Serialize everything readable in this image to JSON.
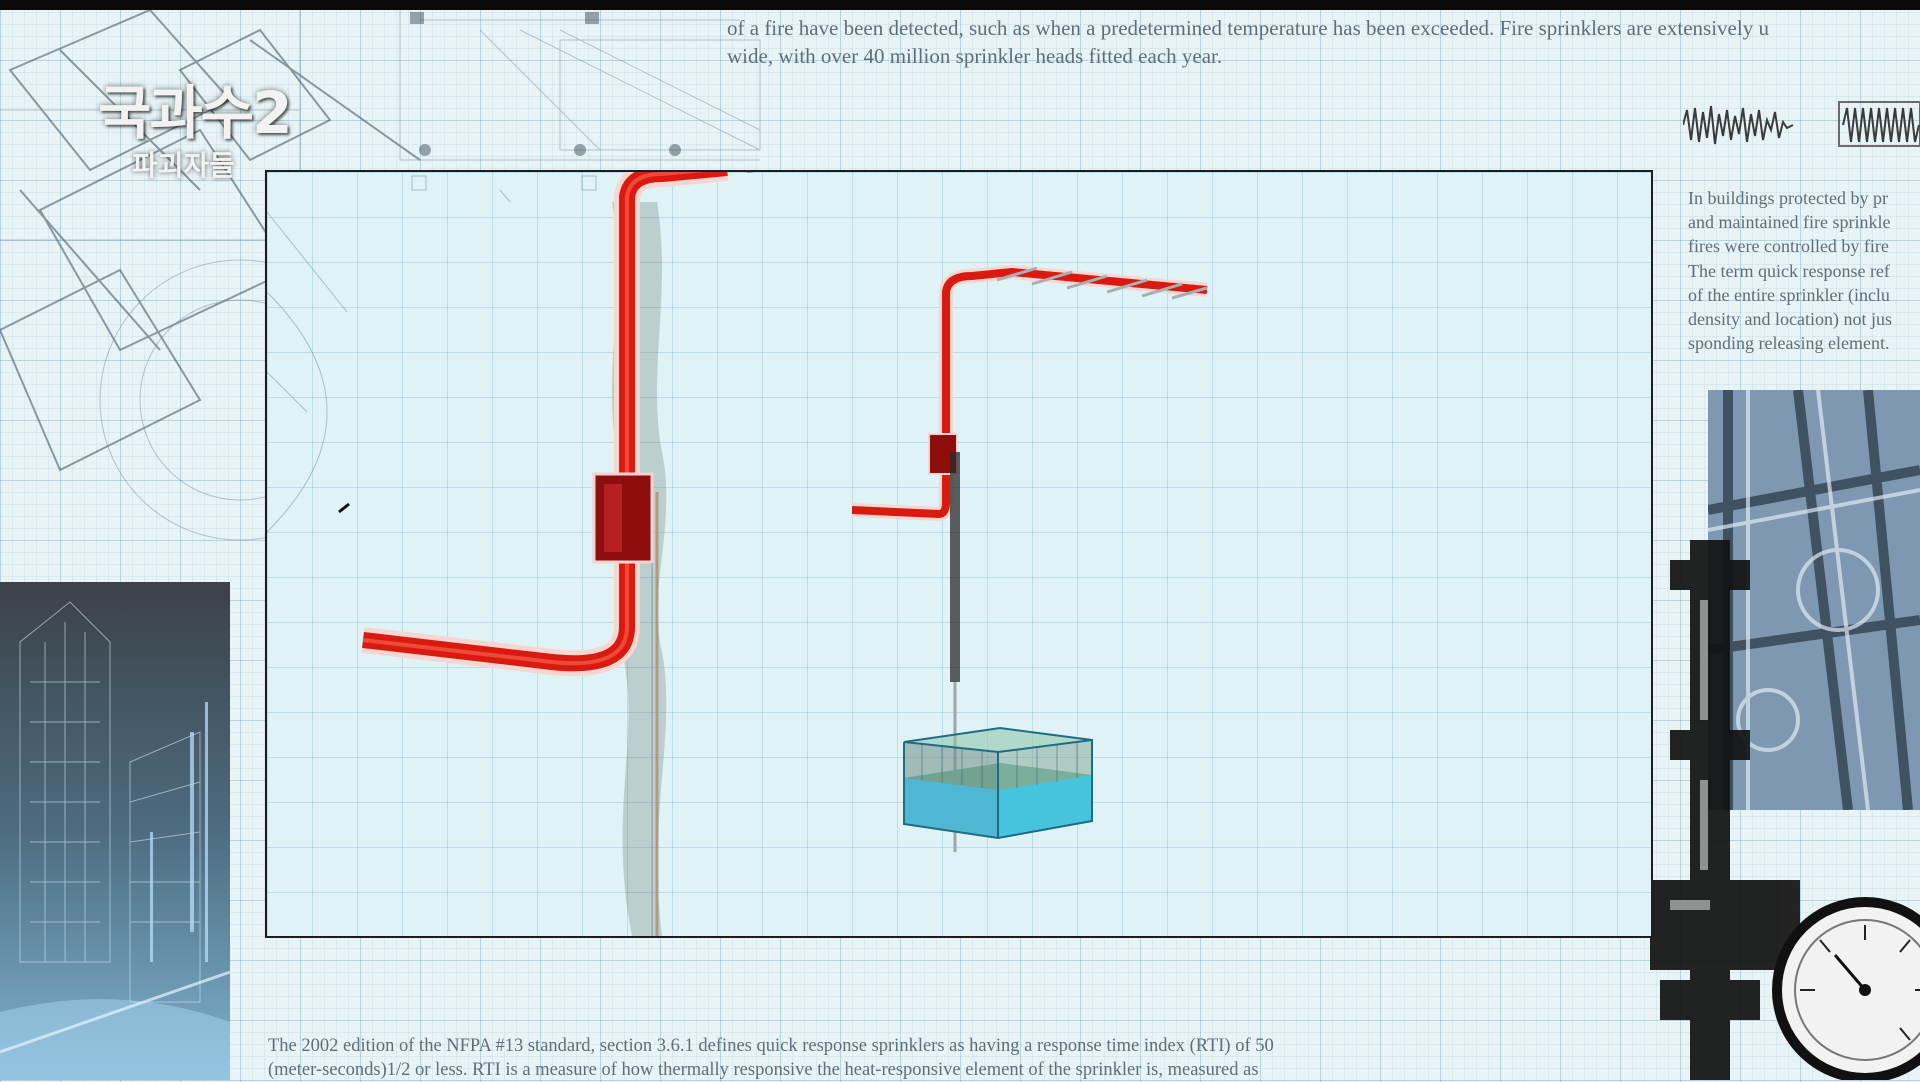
{
  "logo": {
    "title": "국과수2",
    "subtitle": "파괴자들"
  },
  "text": {
    "top_lines": [
      "of a fire have been detected, such as when a predetermined temperature has been exceeded. Fire sprinklers are extensively u",
      "wide, with over 40 million sprinkler heads fitted each year."
    ],
    "right_lines": [
      "In buildings protected by pr",
      "and maintained fire sprinkle",
      "fires were controlled by fire",
      "The term quick response ref",
      "of the entire sprinkler (inclu",
      "density and location) not jus",
      "sponding releasing element."
    ],
    "bottom_lines": [
      "The 2002 edition of the NFPA #13 standard, section 3.6.1 defines quick response sprinklers as having a response time index (RTI) of 50",
      "(meter-seconds)1/2 or less. RTI is a measure of how thermally responsive the heat-responsive element of the sprinkler is, measured as"
    ]
  },
  "colors": {
    "pipe_red": "#d81a10",
    "pipe_dark": "#8e0d0d",
    "tank_water": "#3fc0dc",
    "tank_top": "#7fb79a",
    "grid": "#78aabe",
    "background": "#e8f3f6"
  },
  "icons": [
    "sprinkler-head-icon",
    "pressure-gauge-icon",
    "waveform-icon"
  ]
}
